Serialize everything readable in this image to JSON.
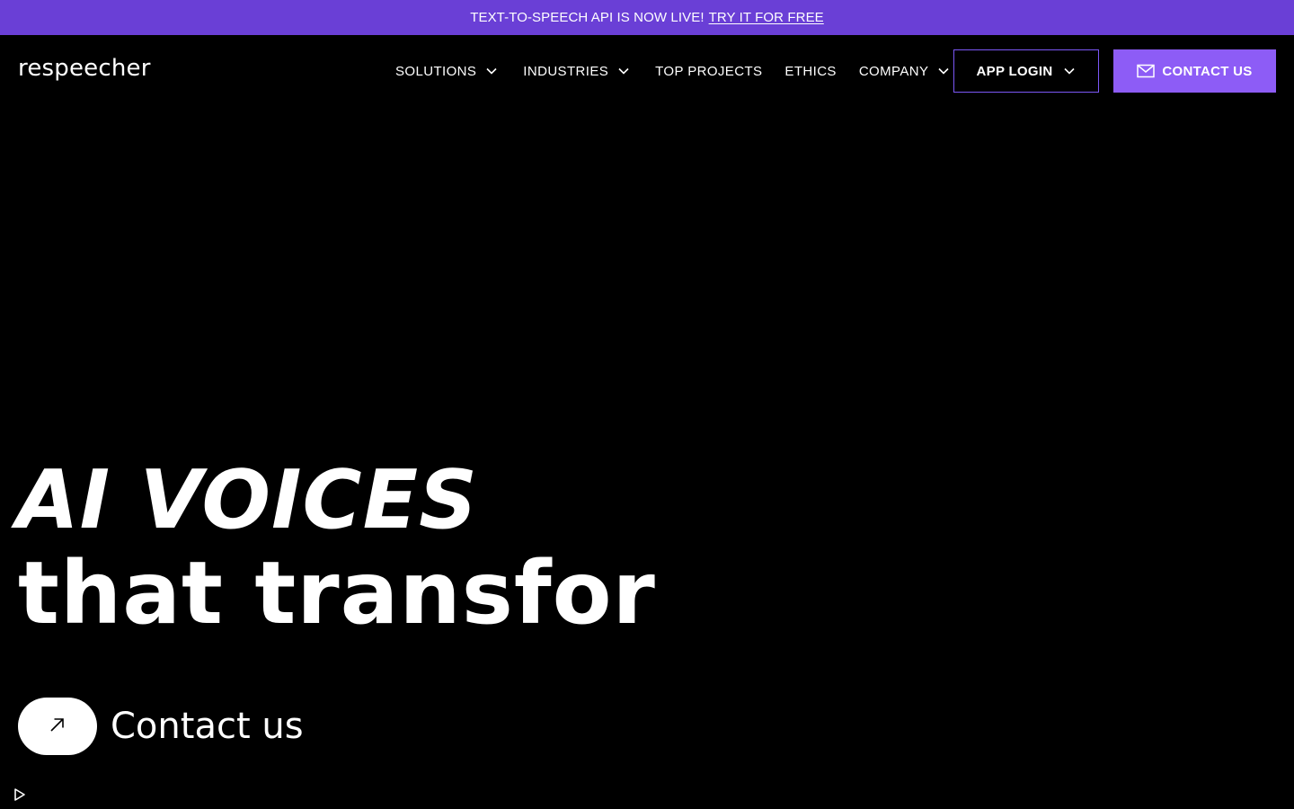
{
  "announcement": {
    "text": "TEXT-TO-SPEECH API IS NOW LIVE!",
    "link_label": "TRY IT FOR FREE"
  },
  "header": {
    "logo": "respeecher",
    "nav": [
      {
        "label": "SOLUTIONS",
        "has_dropdown": true
      },
      {
        "label": "INDUSTRIES",
        "has_dropdown": true
      },
      {
        "label": "TOP PROJECTS",
        "has_dropdown": false
      },
      {
        "label": "ETHICS",
        "has_dropdown": false
      },
      {
        "label": "COMPANY",
        "has_dropdown": true
      }
    ],
    "app_login_label": "APP LOGIN",
    "contact_label": "CONTACT US"
  },
  "hero": {
    "line1": "AI VOICES",
    "line2": "that transfor",
    "cta_label": "Contact us"
  },
  "icons": {
    "chevron": "chevron-down-icon",
    "mail": "mail-icon",
    "arrow": "arrow-up-right-icon",
    "play": "play-icon"
  },
  "colors": {
    "announcement_bg": "#6a3fd6",
    "accent": "#8d5cf6",
    "app_login_border": "#7b57f5",
    "background": "#000000",
    "text": "#ffffff"
  }
}
